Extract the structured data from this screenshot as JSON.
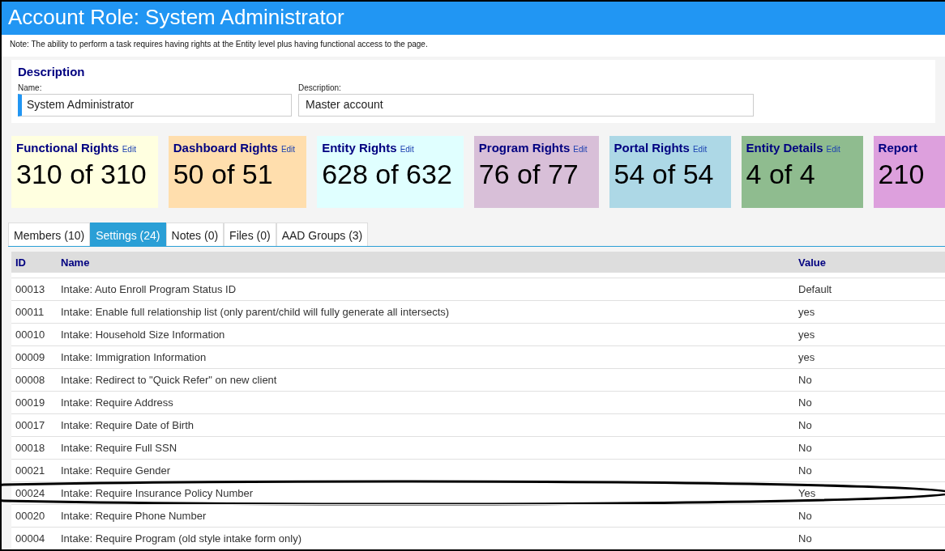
{
  "window": {
    "title": "Account Role: System Administrator"
  },
  "note": "Note: The ability to perform a task requires having rights at the Entity level plus having functional access to the page.",
  "description": {
    "heading": "Description",
    "fields": [
      {
        "label": "Name:",
        "value": "System Administrator",
        "focused": true
      },
      {
        "label": "Description:",
        "value": "Master account",
        "focused": false
      }
    ]
  },
  "cards": [
    {
      "title": "Functional Rights",
      "edit": "Edit",
      "count": "310 of 310",
      "color": "#ffffe0"
    },
    {
      "title": "Dashboard Rights",
      "edit": "Edit",
      "count": "50 of 51",
      "color": "#ffdead"
    },
    {
      "title": "Entity Rights",
      "edit": "Edit",
      "count": "628 of 632",
      "color": "#e0ffff"
    },
    {
      "title": "Program Rights",
      "edit": "Edit",
      "count": "76 of 77",
      "color": "#d8bfd8"
    },
    {
      "title": "Portal Rights",
      "edit": "Edit",
      "count": "54 of 54",
      "color": "#add8e6"
    },
    {
      "title": "Entity Details",
      "edit": "Edit",
      "count": "4 of 4",
      "color": "#8fbc8f"
    },
    {
      "title": "Report",
      "count": "210",
      "color": "#dda0dd"
    }
  ],
  "tabs": [
    {
      "label": "Members (10)",
      "selected": false
    },
    {
      "label": "Settings (24)",
      "selected": true
    },
    {
      "label": "Notes (0)",
      "selected": false
    },
    {
      "label": "Files (0)",
      "selected": false
    },
    {
      "label": "AAD Groups (3)",
      "selected": false
    }
  ],
  "table": {
    "columns": [
      "ID",
      "Name",
      "Value"
    ],
    "rows": [
      {
        "id": "00013",
        "name": "Intake: Auto Enroll Program Status ID",
        "value": "Default",
        "circled": false
      },
      {
        "id": "00011",
        "name": "Intake: Enable full relationship list (only parent/child will fully generate all intersects)",
        "value": "yes",
        "circled": false
      },
      {
        "id": "00010",
        "name": "Intake: Household Size Information",
        "value": "yes",
        "circled": false
      },
      {
        "id": "00009",
        "name": "Intake: Immigration Information",
        "value": "yes",
        "circled": false
      },
      {
        "id": "00008",
        "name": "Intake: Redirect to \"Quick Refer\" on new client",
        "value": "No",
        "circled": false
      },
      {
        "id": "00019",
        "name": "Intake: Require Address",
        "value": "No",
        "circled": false
      },
      {
        "id": "00017",
        "name": "Intake: Require Date of Birth",
        "value": "No",
        "circled": false
      },
      {
        "id": "00018",
        "name": "Intake: Require Full SSN",
        "value": "No",
        "circled": false
      },
      {
        "id": "00021",
        "name": "Intake: Require Gender",
        "value": "No",
        "circled": false
      },
      {
        "id": "00024",
        "name": "Intake: Require Insurance Policy Number",
        "value": "Yes",
        "circled": true
      },
      {
        "id": "00020",
        "name": "Intake: Require Phone Number",
        "value": "No",
        "circled": false
      },
      {
        "id": "00004",
        "name": "Intake: Require Program (old style intake form only)",
        "value": "No",
        "circled": false
      }
    ]
  }
}
